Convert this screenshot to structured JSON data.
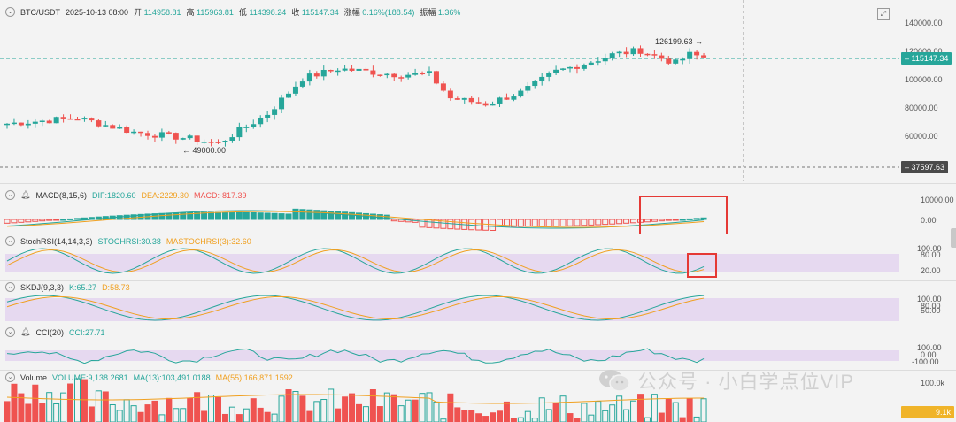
{
  "header": {
    "symbol": "BTC/USDT",
    "datetime": "2025-10-13 08:00",
    "open_label": "开",
    "open": "114958.81",
    "high_label": "高",
    "high": "115963.81",
    "low_label": "低",
    "low": "114398.24",
    "close_label": "收",
    "close": "115147.34",
    "change_label": "涨幅",
    "change": "0.16%(188.54)",
    "amp_label": "振幅",
    "amp": "1.36%"
  },
  "price_axis": {
    "ticks": [
      "140000.00",
      "120000.00",
      "100000.00",
      "80000.00",
      "60000.00"
    ],
    "current_price": "115147.34",
    "crosshair_price": "37597.63",
    "high_marker": "126199.63",
    "low_marker": "49000.00"
  },
  "macd": {
    "label": "MACD(8,15,6)",
    "dif": "DIF:1820.60",
    "dea": "DEA:2229.30",
    "macd": "MACD:-817.39",
    "ticks": [
      "10000.00",
      "0.00"
    ]
  },
  "stochrsi": {
    "label": "StochRSI(14,14,3,3)",
    "k": "STOCHRSI:30.38",
    "d": "MASTOCHRSI(3):32.60",
    "ticks": [
      "100.00",
      "80.00",
      "20.00"
    ]
  },
  "skdj": {
    "label": "SKDJ(9,3,3)",
    "k": "K:65.27",
    "d": "D:58.73",
    "ticks": [
      "100.00",
      "80.00",
      "50.00"
    ]
  },
  "cci": {
    "label": "CCI(20)",
    "value": "CCI:27.71",
    "ticks": [
      "100.00",
      "0.00",
      "-100.00"
    ]
  },
  "volume": {
    "label": "Volume",
    "value": "VOLUME:9,138.2681",
    "ma13": "MA(13):103,491.0188",
    "ma55": "MA(55):166,871.1592",
    "tick": "100.0k",
    "current_tag": "9.1k"
  },
  "watermark": {
    "text": "公众号 · 小白学点位VIP"
  },
  "colors": {
    "up": "#26a69a",
    "down": "#ef5350",
    "dif": "#26a69a",
    "dea": "#f0a020",
    "macd_label": "#ef5350",
    "band": "#e6d9f0",
    "highlight_box": "#e53935"
  }
}
